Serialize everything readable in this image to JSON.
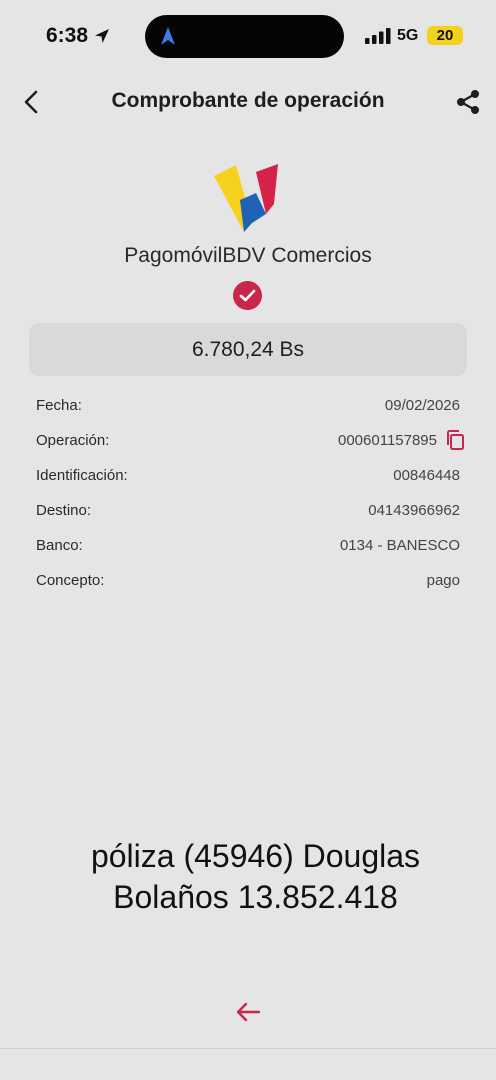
{
  "status_bar": {
    "time": "6:38",
    "network": "5G",
    "battery": "20",
    "location_icon": "location-arrow-icon",
    "signal_icon": "signal-bars-icon"
  },
  "header": {
    "title": "Comprobante de operación",
    "back_icon": "chevron-left-icon",
    "share_icon": "share-icon"
  },
  "brand": {
    "name": "PagomóvilBDV Comercios",
    "logo_colors": [
      "#f7d21c",
      "#1f63b6",
      "#d6224a"
    ]
  },
  "status_icon": "check-circle-icon",
  "amount": "6.780,24 Bs",
  "details": [
    {
      "label": "Fecha:",
      "value": "09/02/2026"
    },
    {
      "label": "Operación:",
      "value": "000601157895"
    },
    {
      "label": "Identificación:",
      "value": "00846448"
    },
    {
      "label": "Destino:",
      "value": "04143966962"
    },
    {
      "label": "Banco:",
      "value": "0134 - BANESCO"
    },
    {
      "label": "Concepto:",
      "value": "pago"
    }
  ],
  "caption": {
    "line1": "póliza (45946) Douglas",
    "line2": "Bolaños 13.852.418"
  },
  "colors": {
    "background": "#e5e5e5",
    "accent": "#c8264a",
    "amount_box": "#d9d9d9"
  }
}
